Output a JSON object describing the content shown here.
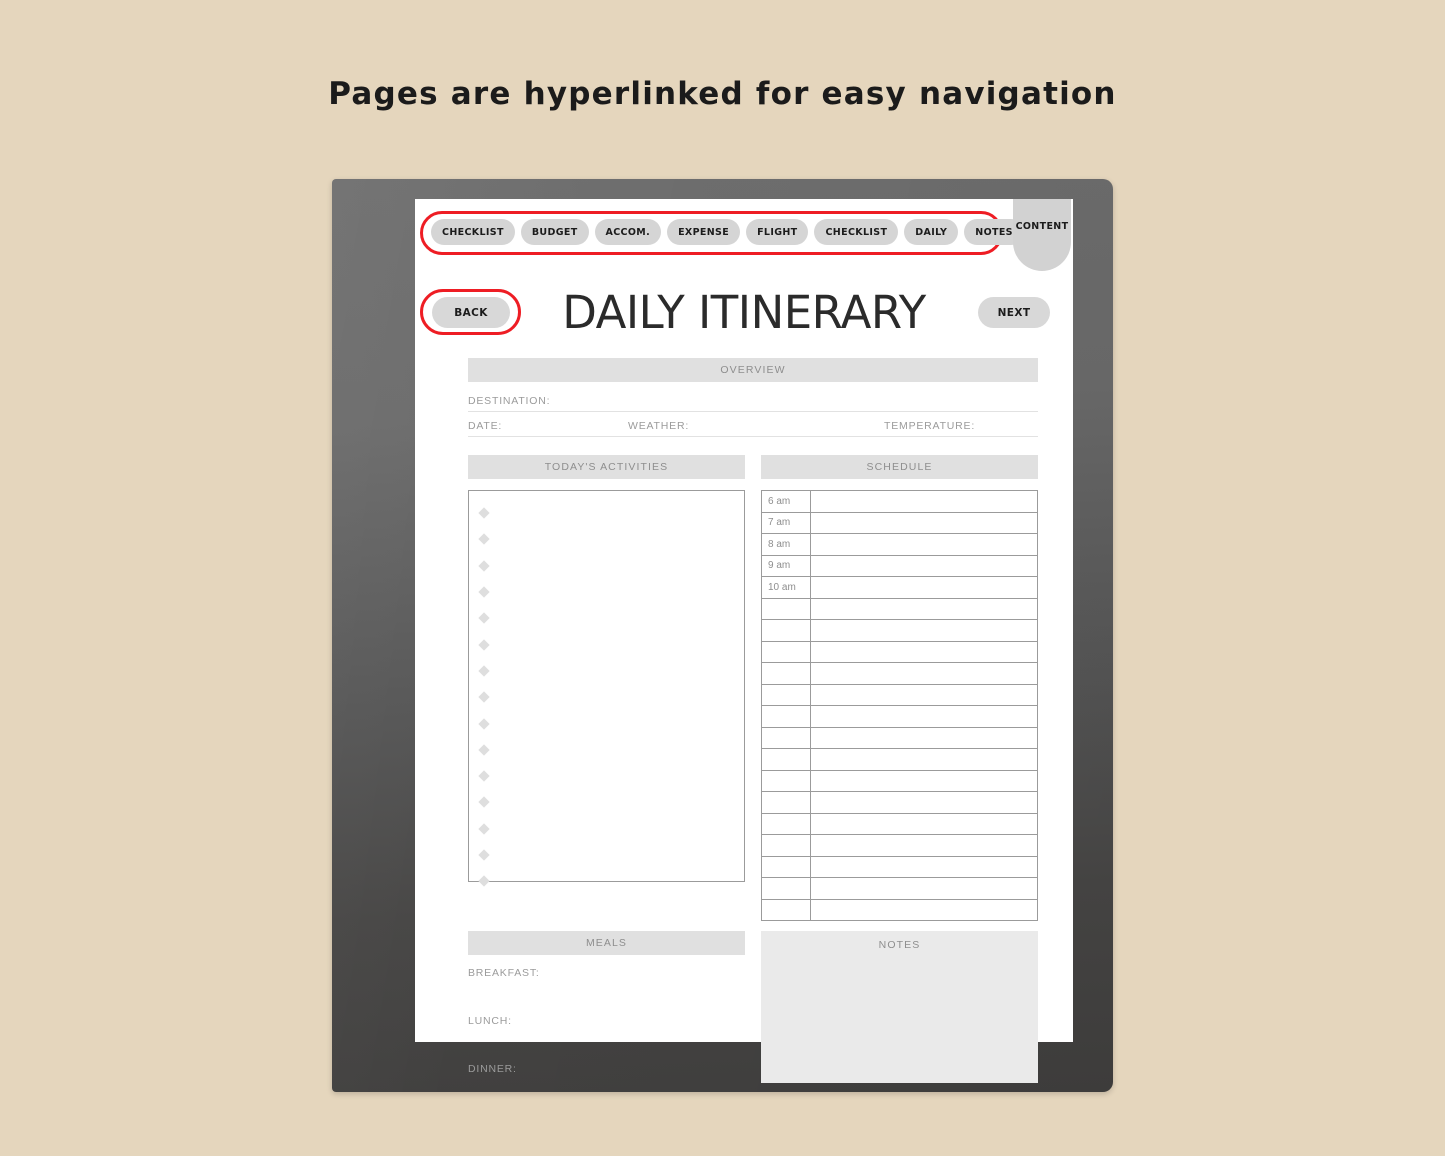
{
  "headline": "Pages are hyperlinked for easy navigation",
  "colors": {
    "background": "#e5d6bd",
    "highlight": "#ee1d24",
    "tab_fill": "#d5d5d5",
    "band_fill": "#e0e0e0",
    "notes_fill": "#eaeaea"
  },
  "nav": {
    "tabs": [
      "CHECKLIST",
      "BUDGET",
      "ACCOM.",
      "EXPENSE",
      "FLIGHT",
      "CHECKLIST",
      "DAILY",
      "NOTES"
    ],
    "content_tab": "CONTENT",
    "back_label": "BACK",
    "next_label": "NEXT"
  },
  "document": {
    "title": "DAILY ITINERARY",
    "overview_band": "OVERVIEW",
    "fields": {
      "destination": "DESTINATION:",
      "date": "DATE:",
      "weather": "WEATHER:",
      "temperature": "TEMPERATURE:"
    },
    "activities": {
      "heading": "TODAY'S ACTIVITIES",
      "bullet_count": 15
    },
    "schedule": {
      "heading": "SCHEDULE",
      "times": [
        "6 am",
        "7 am",
        "8 am",
        "9 am",
        "10 am"
      ],
      "total_rows": 20
    },
    "meals": {
      "heading": "MEALS",
      "items": [
        "BREAKFAST:",
        "LUNCH:",
        "DINNER:"
      ]
    },
    "notes": {
      "heading": "NOTES"
    }
  }
}
